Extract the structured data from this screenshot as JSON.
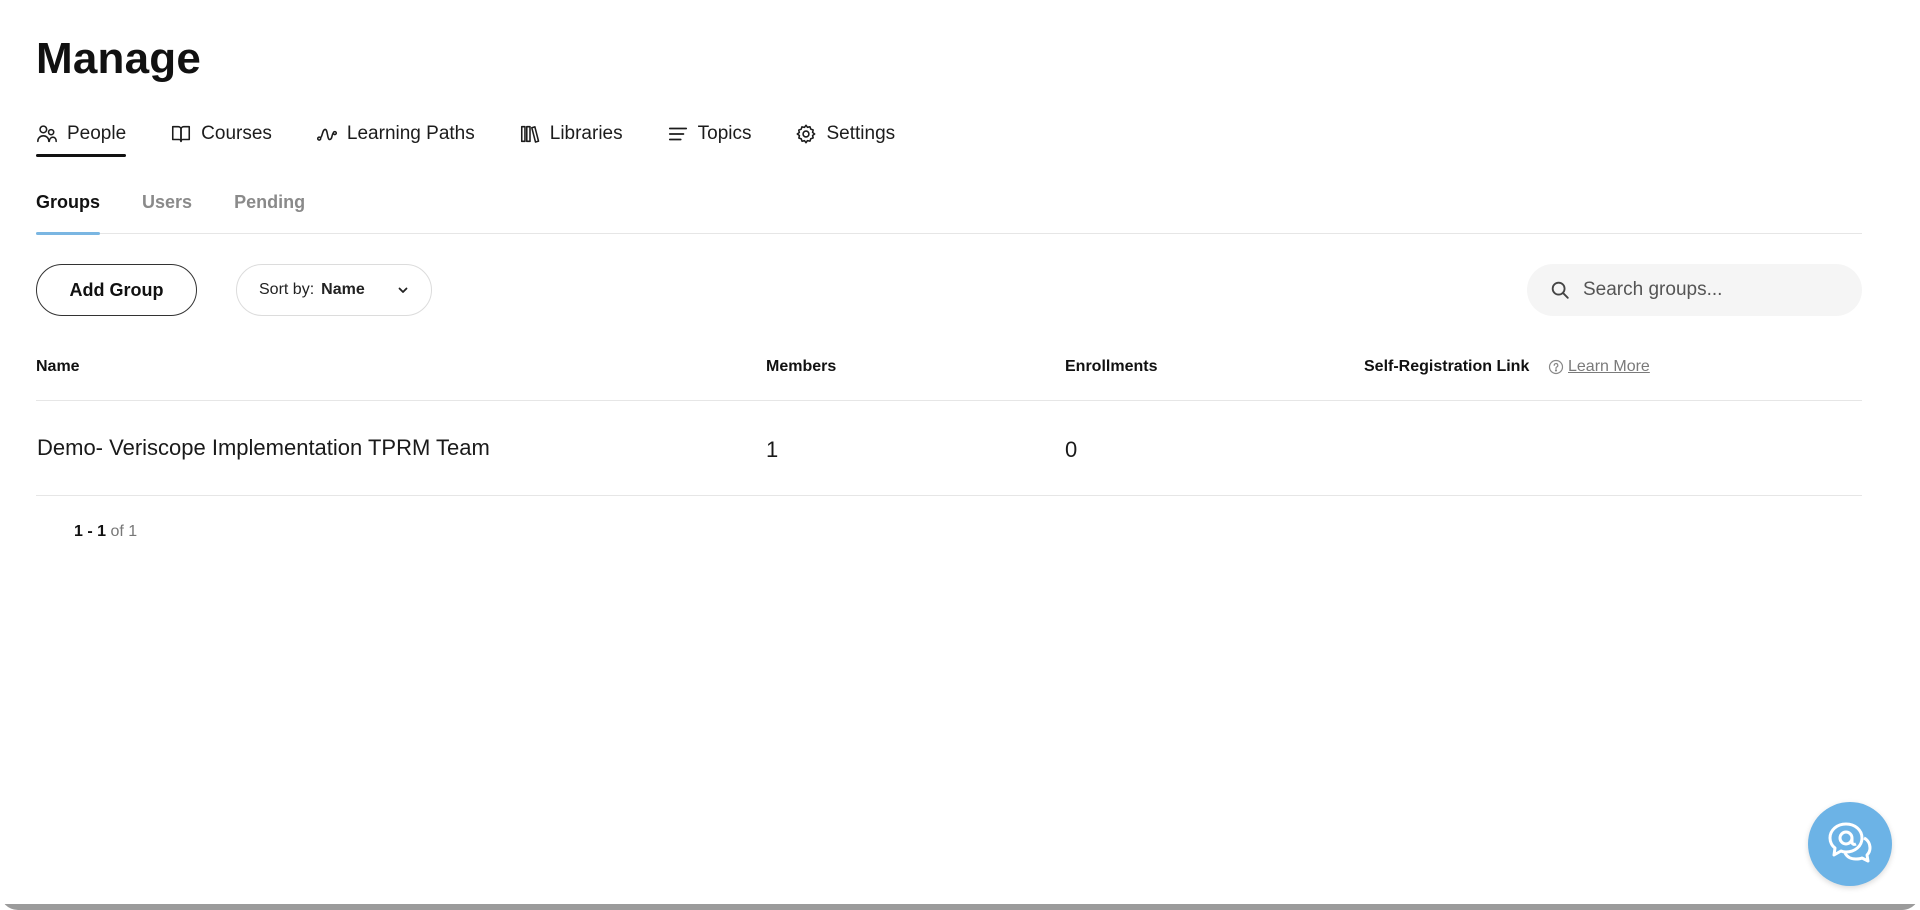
{
  "page": {
    "title": "Manage"
  },
  "main_nav": {
    "items": [
      {
        "label": "People",
        "icon": "people-icon",
        "active": true
      },
      {
        "label": "Courses",
        "icon": "book-icon"
      },
      {
        "label": "Learning Paths",
        "icon": "path-icon"
      },
      {
        "label": "Libraries",
        "icon": "libraries-icon"
      },
      {
        "label": "Topics",
        "icon": "list-icon"
      },
      {
        "label": "Settings",
        "icon": "gear-icon"
      }
    ]
  },
  "sub_tabs": {
    "items": [
      {
        "label": "Groups",
        "active": true
      },
      {
        "label": "Users"
      },
      {
        "label": "Pending"
      }
    ]
  },
  "toolbar": {
    "add_label": "Add Group",
    "sort_prefix": "Sort by:",
    "sort_value": "Name",
    "search_placeholder": "Search groups..."
  },
  "table": {
    "columns": {
      "name": "Name",
      "members": "Members",
      "enrollments": "Enrollments",
      "self_registration": "Self-Registration Link",
      "learn_more": "Learn More"
    },
    "rows": [
      {
        "name": "Demo- Veriscope Implementation TPRM Team",
        "members": "1",
        "enrollments": "0"
      }
    ]
  },
  "pagination": {
    "range": "1 - 1",
    "of": "of 1"
  },
  "colors": {
    "accent": "#7ab6e2",
    "fab": "#6cb3e6",
    "text": "#111111",
    "muted": "#8a8a8a"
  }
}
